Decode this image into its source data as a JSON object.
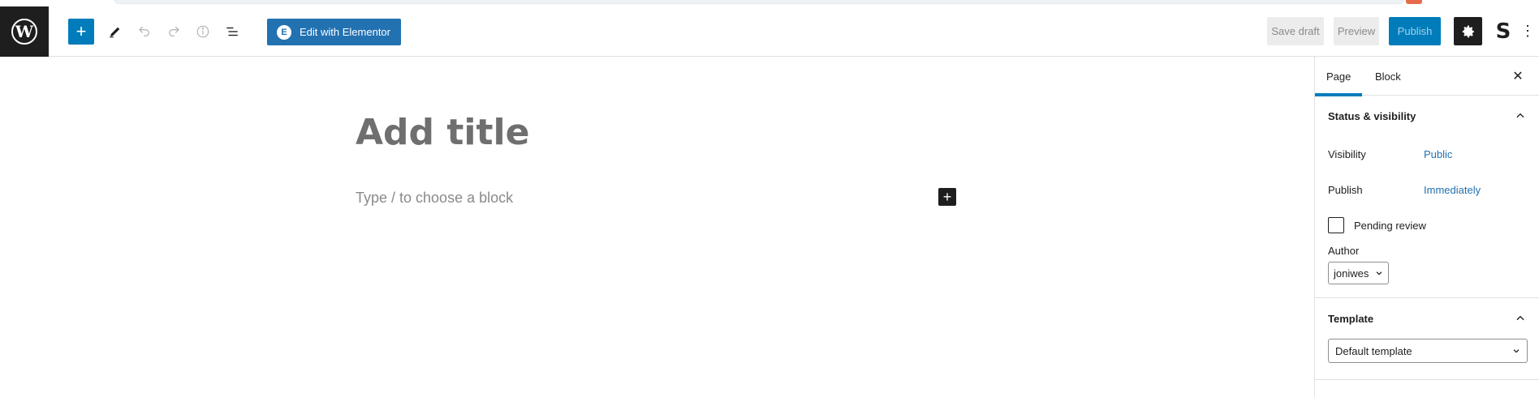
{
  "topbar": {
    "add_block_symbol": "+",
    "elementor_label": "Edit with Elementor",
    "elementor_badge": "E",
    "save_draft_label": "Save draft",
    "preview_label": "Preview",
    "publish_label": "Publish",
    "settings_icon": "gear-icon",
    "plugin_icon_letter": "S",
    "kebab_symbol": "⋮"
  },
  "editor": {
    "title_placeholder": "Add title",
    "block_placeholder": "Type / to choose a block",
    "inserter_symbol": "+"
  },
  "sidebar": {
    "tabs": [
      {
        "label": "Page",
        "active": true
      },
      {
        "label": "Block",
        "active": false
      }
    ],
    "close_symbol": "✕",
    "status_panel": {
      "title": "Status & visibility",
      "visibility_label": "Visibility",
      "visibility_value": "Public",
      "publish_label": "Publish",
      "publish_value": "Immediately",
      "pending_review_label": "Pending review",
      "author_label": "Author",
      "author_value": "joniwes"
    },
    "template_panel": {
      "title": "Template",
      "template_value": "Default template"
    }
  },
  "colors": {
    "accent": "#007cba",
    "link": "#2271b1",
    "dark": "#1e1e1e"
  }
}
